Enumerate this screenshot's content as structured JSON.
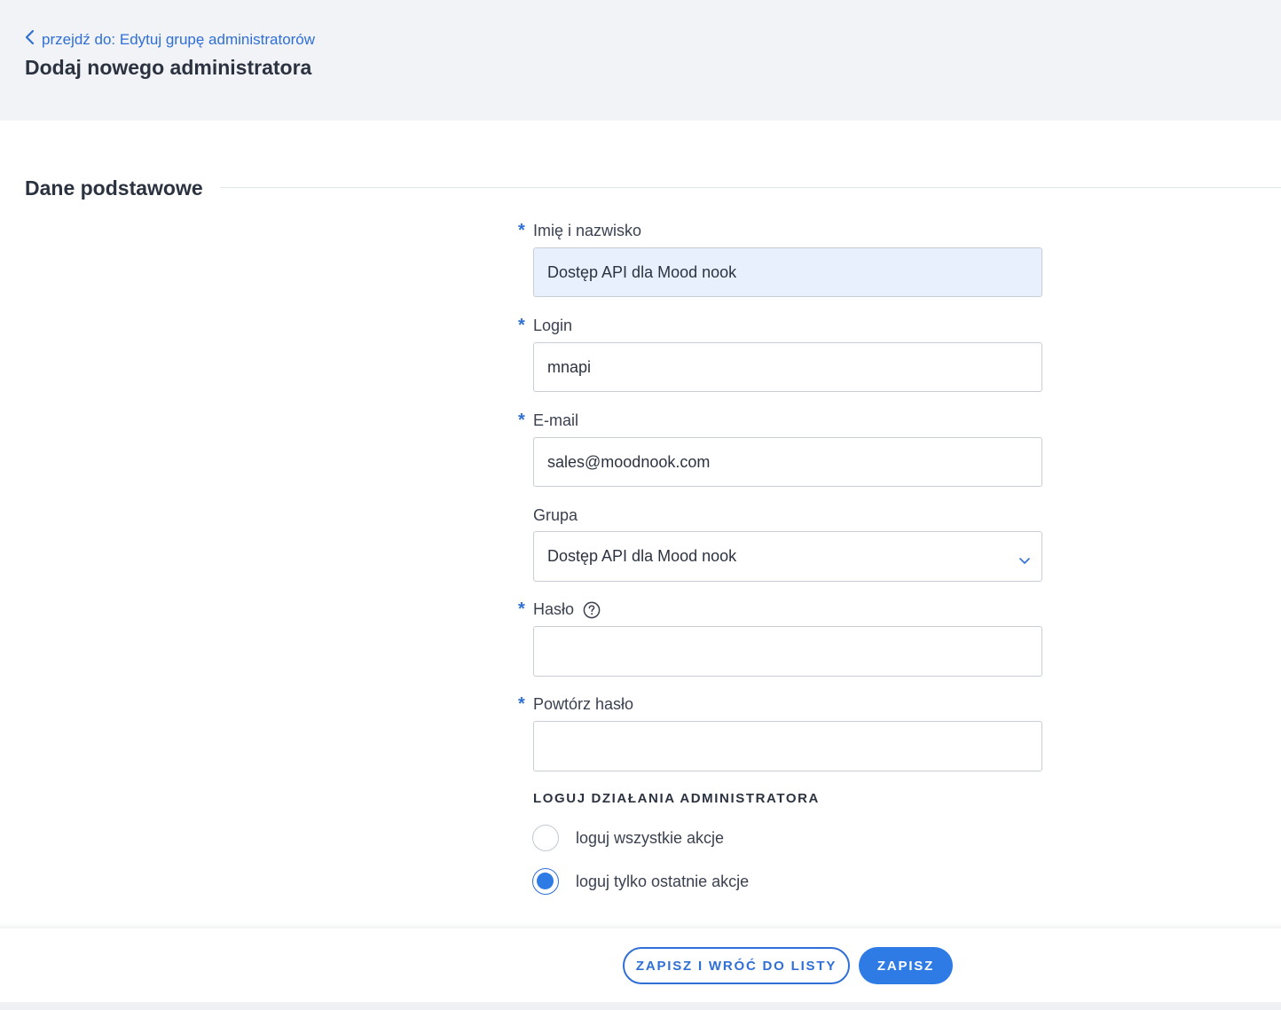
{
  "header": {
    "back_link": "przejdź do: Edytuj grupę administratorów",
    "title": "Dodaj nowego administratora"
  },
  "section": {
    "title": "Dane podstawowe"
  },
  "form": {
    "required_marker": "*",
    "full_name": {
      "label": "Imię i nazwisko",
      "value": "Dostęp API dla Mood nook",
      "required": true
    },
    "login": {
      "label": "Login",
      "value": "mnapi",
      "required": true
    },
    "email": {
      "label": "E-mail",
      "value": "sales@moodnook.com",
      "required": true
    },
    "group": {
      "label": "Grupa",
      "value": "Dostęp API dla Mood nook",
      "required": false
    },
    "password": {
      "label": "Hasło",
      "value": "",
      "required": true
    },
    "password_repeat": {
      "label": "Powtórz hasło",
      "value": "",
      "required": true
    },
    "logging": {
      "heading": "LOGUJ DZIAŁANIA ADMINISTRATORA",
      "options": [
        {
          "label": "loguj wszystkie akcje",
          "checked": false
        },
        {
          "label": "loguj tylko ostatnie akcje",
          "checked": true
        }
      ]
    }
  },
  "footer": {
    "save_and_return_label": "ZAPISZ I WRÓĆ DO LISTY",
    "save_label": "ZAPISZ"
  },
  "colors": {
    "accent": "#2f7be6",
    "link": "#2f6fd6",
    "header_bg": "#f2f3f6",
    "autofill_bg": "#e8f0fe"
  },
  "icons": {
    "back": "chevron-left-icon",
    "select": "chevron-down-icon",
    "help": "question-circle-icon"
  }
}
